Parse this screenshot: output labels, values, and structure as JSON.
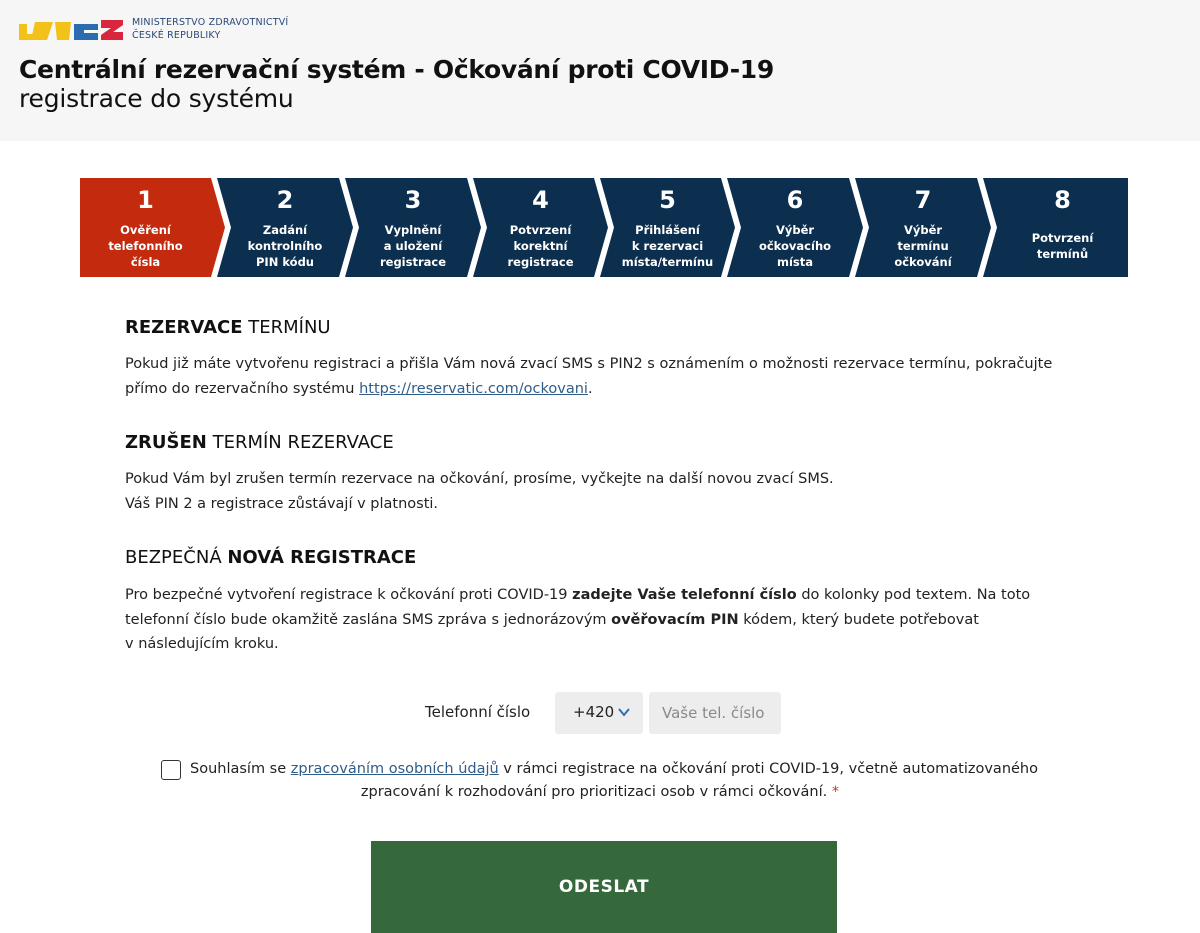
{
  "header": {
    "ministry_line1": "MINISTERSTVO ZDRAVOTNICTVÍ",
    "ministry_line2": "ČESKÉ REPUBLIKY",
    "title": "Centrální rezervační systém - Očkování proti COVID-19",
    "subtitle": "registrace do systému"
  },
  "colors": {
    "step_active": "#c42b0e",
    "step_inactive": "#0d2f4f",
    "submit_bg": "#35683a",
    "link": "#2f5d8a"
  },
  "steps": [
    {
      "num": "1",
      "lines": [
        "Ověření",
        "telefonního",
        "čísla"
      ],
      "active": true
    },
    {
      "num": "2",
      "lines": [
        "Zadání",
        "kontrolního",
        "PIN kódu"
      ],
      "active": false
    },
    {
      "num": "3",
      "lines": [
        "Vyplnění",
        "a uložení",
        "registrace"
      ],
      "active": false
    },
    {
      "num": "4",
      "lines": [
        "Potvrzení",
        "korektní",
        "registrace"
      ],
      "active": false
    },
    {
      "num": "5",
      "lines": [
        "Přihlášení",
        "k rezervaci",
        "místa/termínu"
      ],
      "active": false
    },
    {
      "num": "6",
      "lines": [
        "Výběr",
        "očkovacího",
        "místa"
      ],
      "active": false
    },
    {
      "num": "7",
      "lines": [
        "Výběr",
        "termínu",
        "očkování"
      ],
      "active": false
    },
    {
      "num": "8",
      "lines": [
        "Potvrzení",
        "termínů"
      ],
      "active": false
    }
  ],
  "sections": {
    "reservation": {
      "heading_bold": "REZERVACE",
      "heading_rest": " TERMÍNU",
      "line1": "Pokud již máte vytvořenu registraci a přišla Vám nová zvací SMS s PIN2 s oznámením o možnosti rezervace termínu, pokračujte",
      "line2_pre": "přímo do rezervačního systému ",
      "link": "https://reservatic.com/ockovani",
      "line2_post": "."
    },
    "cancelled": {
      "heading_bold": "ZRUŠEN",
      "heading_rest": " TERMÍN REZERVACE",
      "line1": "Pokud Vám byl zrušen termín rezervace na očkování, prosíme, vyčkejte na další novou zvací SMS.",
      "line2": "Váš PIN 2 a registrace zůstávají v platnosti."
    },
    "new_registration": {
      "heading_pre": "BEZPEČNÁ ",
      "heading_bold": "NOVÁ REGISTRACE",
      "line1_pre": "Pro bezpečné vytvoření registrace k očkování proti COVID-19 ",
      "line1_bold": "zadejte Vaše telefonní číslo",
      "line1_post": " do kolonky pod textem. Na toto",
      "line2_pre": "telefonní číslo bude okamžitě zaslána SMS zpráva s jednorázovým ",
      "line2_bold": "ověřovacím PIN",
      "line2_post": " kódem, který budete potřebovat",
      "line3": "v následujícím kroku."
    }
  },
  "form": {
    "phone_label": "Telefonní číslo",
    "prefix": "+420",
    "phone_placeholder": "Vaše tel. číslo",
    "consent_pre": "Souhlasím se ",
    "consent_link": "zpracováním osobních údajů",
    "consent_post": " v rámci registrace na očkování proti COVID-19, včetně automatizovaného",
    "consent_line2": "zpracování k rozhodování pro prioritizaci osob v rámci očkování.",
    "required_mark": "*",
    "submit_label": "ODESLAT"
  }
}
